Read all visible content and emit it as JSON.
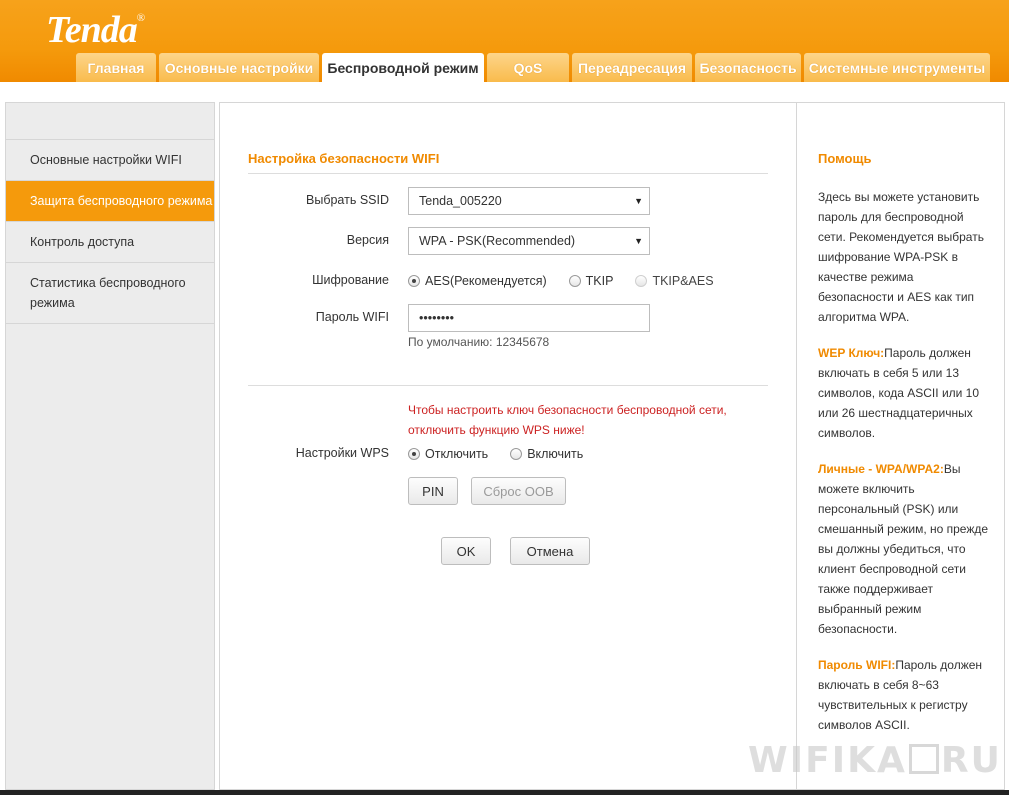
{
  "header": {
    "logo": "Tenda",
    "logo_mark": "®",
    "tabs": [
      {
        "label": "Главная"
      },
      {
        "label": "Основные настройки"
      },
      {
        "label": "Беспроводной режим"
      },
      {
        "label": "QoS"
      },
      {
        "label": "Переадресация"
      },
      {
        "label": "Безопасность"
      },
      {
        "label": "Системные инструменты"
      }
    ],
    "active_tab": "Беспроводной режим"
  },
  "sidebar": {
    "items": [
      {
        "label": "Основные настройки WIFI"
      },
      {
        "label": "Защита беспроводного режима"
      },
      {
        "label": "Контроль доступа"
      },
      {
        "label": "Статистика беспроводного режима"
      }
    ],
    "active_item": "Защита беспроводного режима"
  },
  "main": {
    "title": "Настройка безопасности WIFI",
    "ssid": {
      "label": "Выбрать SSID",
      "value": "Tenda_005220"
    },
    "version": {
      "label": "Версия",
      "value": "WPA - PSK(Recommended)"
    },
    "encryption": {
      "label": "Шифрование",
      "options": [
        "AES(Рекомендуется)",
        "TKIP",
        "TKIP&AES"
      ],
      "selected": "AES(Рекомендуется)"
    },
    "password": {
      "label": "Пароль WIFI",
      "value": "••••••••",
      "default_hint": "По умолчанию: 12345678"
    },
    "wps_warning": "Чтобы настроить ключ безопасности беспроводной сети, отключить функцию WPS ниже!",
    "wps": {
      "label": "Настройки WPS",
      "options": [
        "Отключить",
        "Включить"
      ],
      "selected": "Отключить",
      "pin_label": "PIN",
      "reset_label": "Сброс OOB"
    },
    "ok_label": "OK",
    "cancel_label": "Отмена"
  },
  "help": {
    "title": "Помощь",
    "intro": "Здесь вы можете установить пароль для беспроводной сети. Рекомендуется выбрать шифрование WPA-PSK в качестве режима безопасности и AES как тип алгоритма WPA.",
    "wep_title": "WEP Ключ:",
    "wep_text": "Пароль должен включать в себя 5 или 13 символов, кода ASCII или 10 или 26 шестнадцатеричных символов.",
    "personal_title": "Личные - WPA/WPA2:",
    "personal_text": "Вы можете включить персональный (PSK) или смешанный режим, но прежде вы должны убедиться, что клиент беспроводной сети также поддерживает выбранный режим безопасности.",
    "password_title": "Пароль WIFI:",
    "password_text": "Пароль должен включать в себя 8~63 чувствительных к регистру символов ASCII."
  },
  "watermark": {
    "left": "WIFIKA",
    "right": "RU"
  }
}
